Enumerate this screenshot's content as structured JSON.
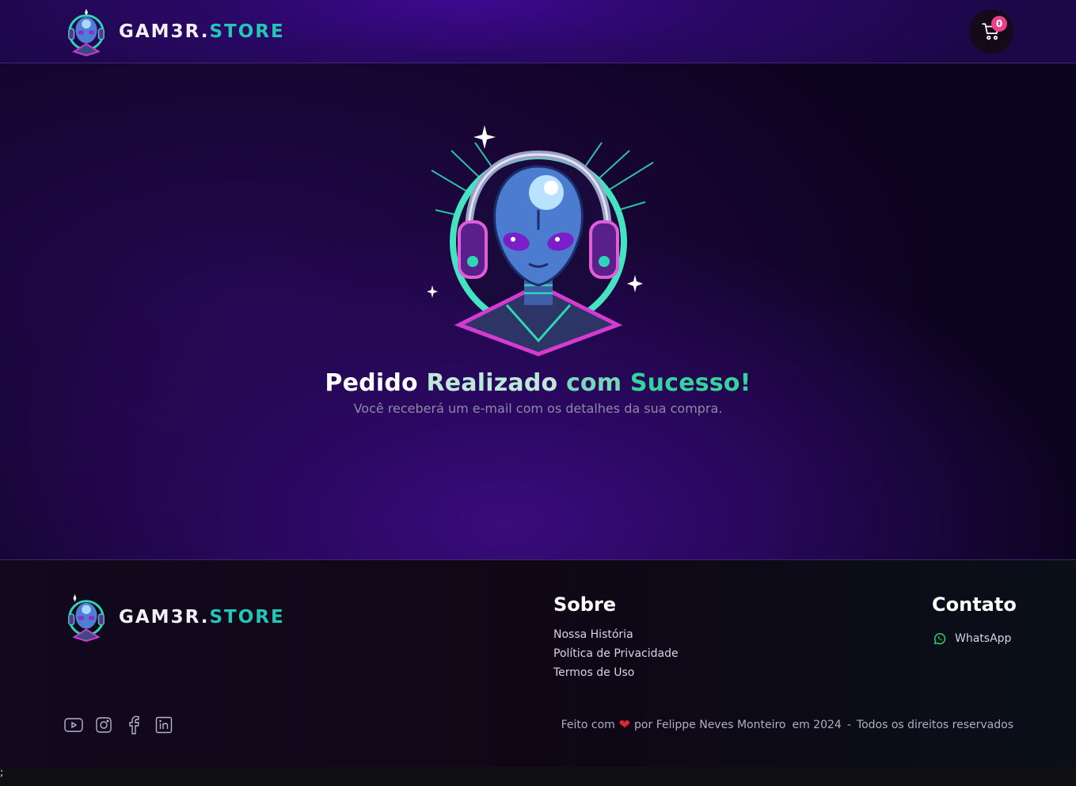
{
  "header": {
    "brand_white": "GAM3R.",
    "brand_accent": "STORE",
    "cart_count": "0"
  },
  "main": {
    "title_parts": [
      "Pedido ",
      "Realizado ",
      "com ",
      "Sucesso!"
    ],
    "subtitle": "Você receberá um e-mail com os detalhes da sua compra."
  },
  "footer": {
    "brand_white": "GAM3R.",
    "brand_accent": "STORE",
    "about": {
      "title": "Sobre",
      "links": [
        "Nossa História",
        "Política de Privacidade",
        "Termos de Uso"
      ]
    },
    "contact": {
      "title": "Contato",
      "whatsapp": "WhatsApp"
    },
    "socials": [
      "youtube-icon",
      "instagram-icon",
      "facebook-icon",
      "linkedin-icon"
    ],
    "credits": {
      "made_with": "Feito com",
      "by": "por Felippe Neves Monteiro",
      "year": "em 2024",
      "sep": "-",
      "rights": "Todos os direitos reservados"
    }
  },
  "bottom_text": ";",
  "colors": {
    "accent": "#24c6b6",
    "badge": "#e7418c",
    "header_bg": "#2a0866",
    "whatsapp": "#25d366"
  }
}
